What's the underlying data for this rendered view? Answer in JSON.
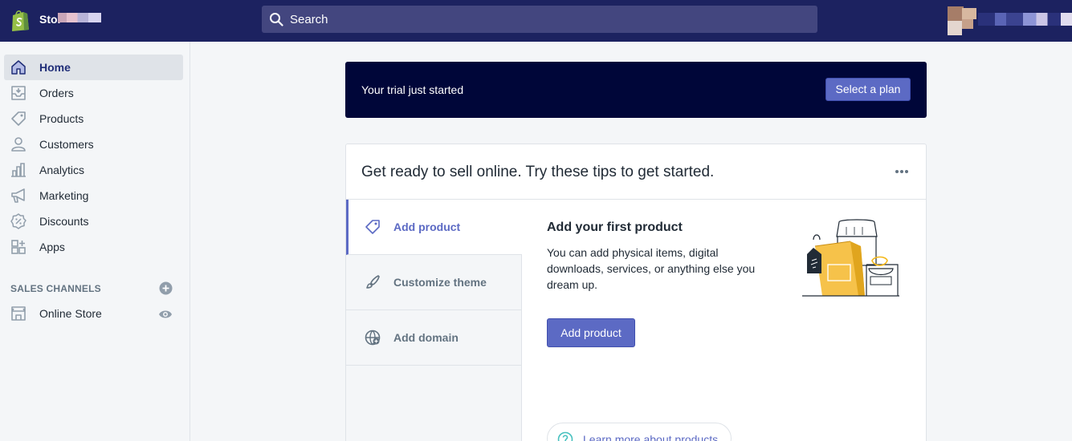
{
  "topbar": {
    "store_name": "Stor",
    "search_placeholder": "Search"
  },
  "sidebar": {
    "items": [
      {
        "label": "Home",
        "icon": "home-icon",
        "active": true
      },
      {
        "label": "Orders",
        "icon": "orders-icon"
      },
      {
        "label": "Products",
        "icon": "tag-icon"
      },
      {
        "label": "Customers",
        "icon": "person-icon"
      },
      {
        "label": "Analytics",
        "icon": "bar-chart-icon"
      },
      {
        "label": "Marketing",
        "icon": "megaphone-icon"
      },
      {
        "label": "Discounts",
        "icon": "discount-icon"
      },
      {
        "label": "Apps",
        "icon": "apps-icon"
      }
    ],
    "sales_channels_title": "SALES CHANNELS",
    "online_store_label": "Online Store"
  },
  "trial": {
    "text": "Your trial just started",
    "button_label": "Select a plan"
  },
  "tips": {
    "title": "Get ready to sell online. Try these tips to get started.",
    "tabs": [
      {
        "label": "Add product",
        "icon": "tag-icon",
        "active": true
      },
      {
        "label": "Customize theme",
        "icon": "brush-icon"
      },
      {
        "label": "Add domain",
        "icon": "globe-icon"
      }
    ],
    "panel": {
      "title": "Add your first product",
      "description": "You can add physical items, digital downloads, services, or anything else you dream up.",
      "button_label": "Add product",
      "learn_more_label": "Learn more about products"
    }
  },
  "colors": {
    "topbar": "#1c2260",
    "search": "#43467f",
    "trial_banner": "#000639",
    "accent": "#5c6ac4"
  }
}
